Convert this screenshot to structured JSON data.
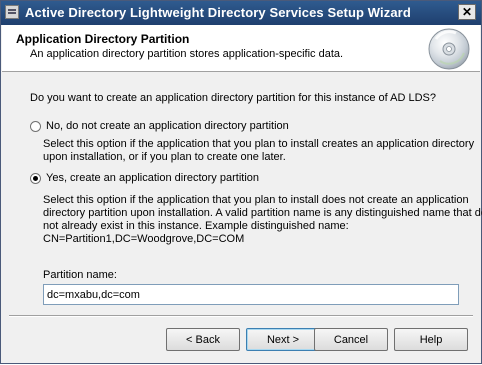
{
  "window": {
    "title": "Active Directory Lightweight Directory Services Setup Wizard",
    "close_glyph": "✕"
  },
  "header": {
    "title": "Application Directory Partition",
    "subtitle": "An application directory partition stores application-specific data.",
    "icon": "cd-disc-icon"
  },
  "question": "Do you want to create an application directory partition for this instance of AD LDS?",
  "options": [
    {
      "label": "No, do not create an application directory partition",
      "checked": false,
      "description": [
        "Select this option if the application that you plan to install creates an application directory",
        "upon installation, or if you plan to create one later."
      ]
    },
    {
      "label": "Yes, create an application directory partition",
      "checked": true,
      "description": [
        "Select this option if the application that you plan to install does not create an application",
        "directory partition upon installation. A valid partition name is any distinguished name that does",
        "not already exist in this instance. Example distinguished name:",
        "CN=Partition1,DC=Woodgrove,DC=COM"
      ]
    }
  ],
  "partition_name": {
    "label": "Partition name:",
    "value": "dc=mxabu,dc=com"
  },
  "buttons": {
    "back": "< Back",
    "next": "Next >",
    "cancel": "Cancel",
    "help": "Help"
  }
}
